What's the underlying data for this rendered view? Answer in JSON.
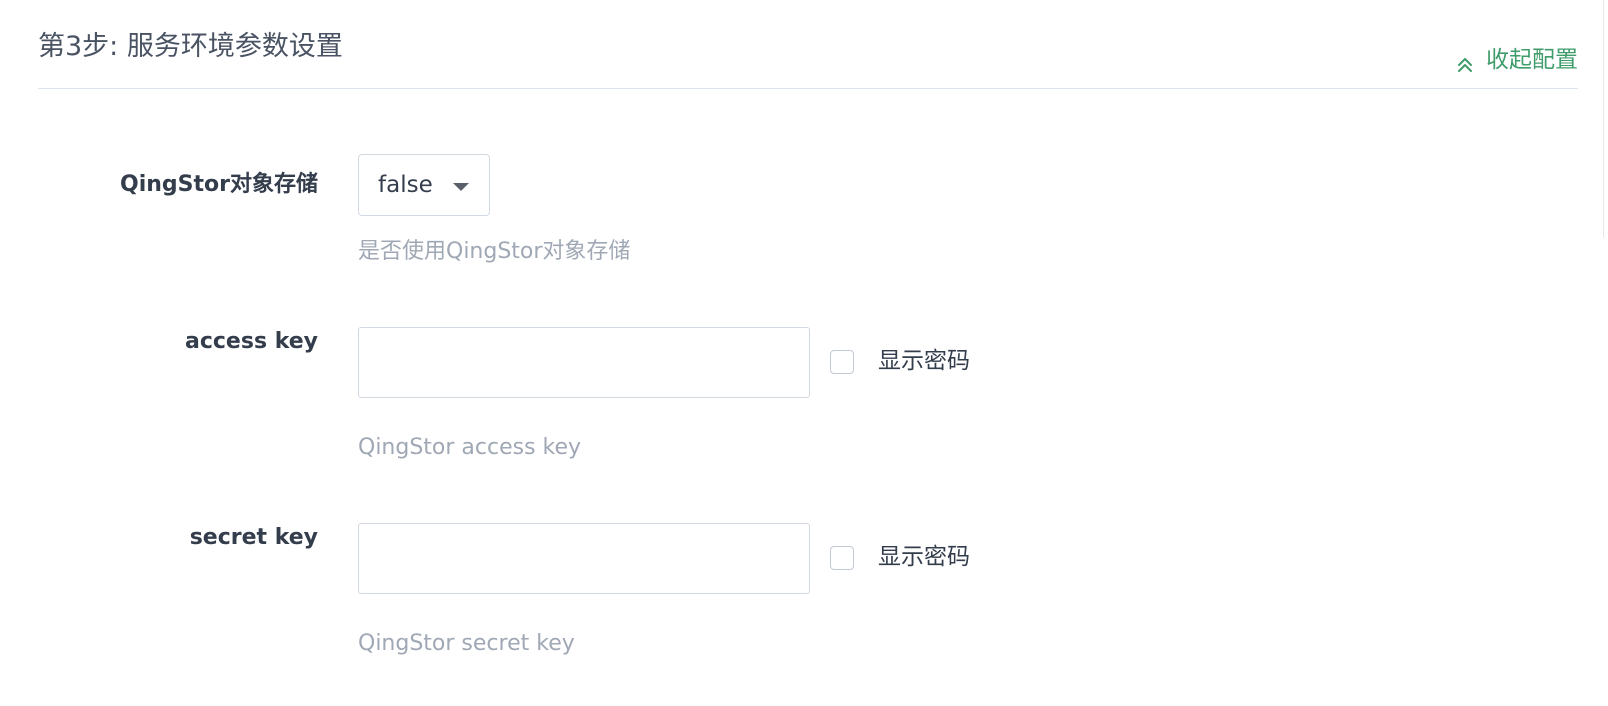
{
  "section": {
    "title": "第3步: 服务环境参数设置",
    "collapse_label": "收起配置",
    "collapse_icon": "double-chevron-up-icon",
    "accent_color": "#3f9c6b"
  },
  "fields": {
    "qingstor": {
      "label": "QingStor对象存储",
      "selected_value": "false",
      "hint": "是否使用QingStor对象存储"
    },
    "access_key": {
      "label": "access key",
      "value": "",
      "show_password_label": "显示密码",
      "show_password_checked": false,
      "hint": "QingStor access key"
    },
    "secret_key": {
      "label": "secret key",
      "value": "",
      "show_password_label": "显示密码",
      "show_password_checked": false,
      "hint": "QingStor secret key"
    }
  }
}
